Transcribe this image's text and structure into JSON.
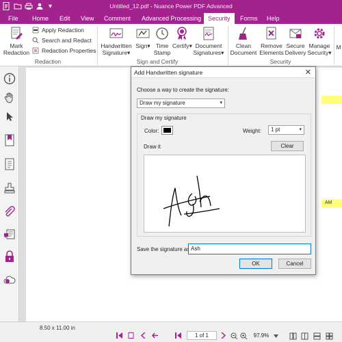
{
  "app": {
    "title": "Untitled_12.pdf - Nuance Power PDF Advanced",
    "brand_color": "#a3238e"
  },
  "menu": {
    "items": [
      "File",
      "Home",
      "Edit",
      "View",
      "Comment",
      "Advanced Processing",
      "Security",
      "Forms",
      "Help"
    ],
    "active": "Security"
  },
  "ribbon": {
    "redaction": {
      "mark_label_1": "Mark",
      "mark_label_2": "Redaction",
      "apply": "Apply Redaction",
      "search": "Search and Redact",
      "properties": "Redaction Properties",
      "group": "Redaction"
    },
    "sign": {
      "handwritten_1": "Handwritten",
      "handwritten_2": "Signature",
      "sign": "Sign",
      "time_1": "Time",
      "time_2": "Stamp",
      "certify": "Certify",
      "docsig_1": "Document",
      "docsig_2": "Signatures",
      "group": "Sign and Certify"
    },
    "security": {
      "clean_1": "Clean",
      "clean_2": "Document",
      "remove_1": "Remove",
      "remove_2": "Elements",
      "secure_1": "Secure",
      "secure_2": "Delivery",
      "manage_1": "Manage",
      "manage_2": "Security",
      "more": "M",
      "group": "Security"
    }
  },
  "document": {
    "highlight_text": "AM"
  },
  "statusbar": {
    "page_size": "8.50 x 11.00 in",
    "page_indicator": "1 of 1",
    "zoom": "97.9%"
  },
  "dialog": {
    "title": "Add Handwritten signature",
    "choose_label": "Choose a way to create the signature:",
    "method": "Draw my signature",
    "group_label": "Draw my signature",
    "color_label": "Color:",
    "pen_color": "#000000",
    "weight_label": "Weight:",
    "weight": "1 pt",
    "clear": "Clear",
    "draw_it": "Draw it",
    "save_as_label": "Save the signature as:",
    "save_as_value": "Ash",
    "ok": "OK",
    "cancel": "Cancel"
  }
}
